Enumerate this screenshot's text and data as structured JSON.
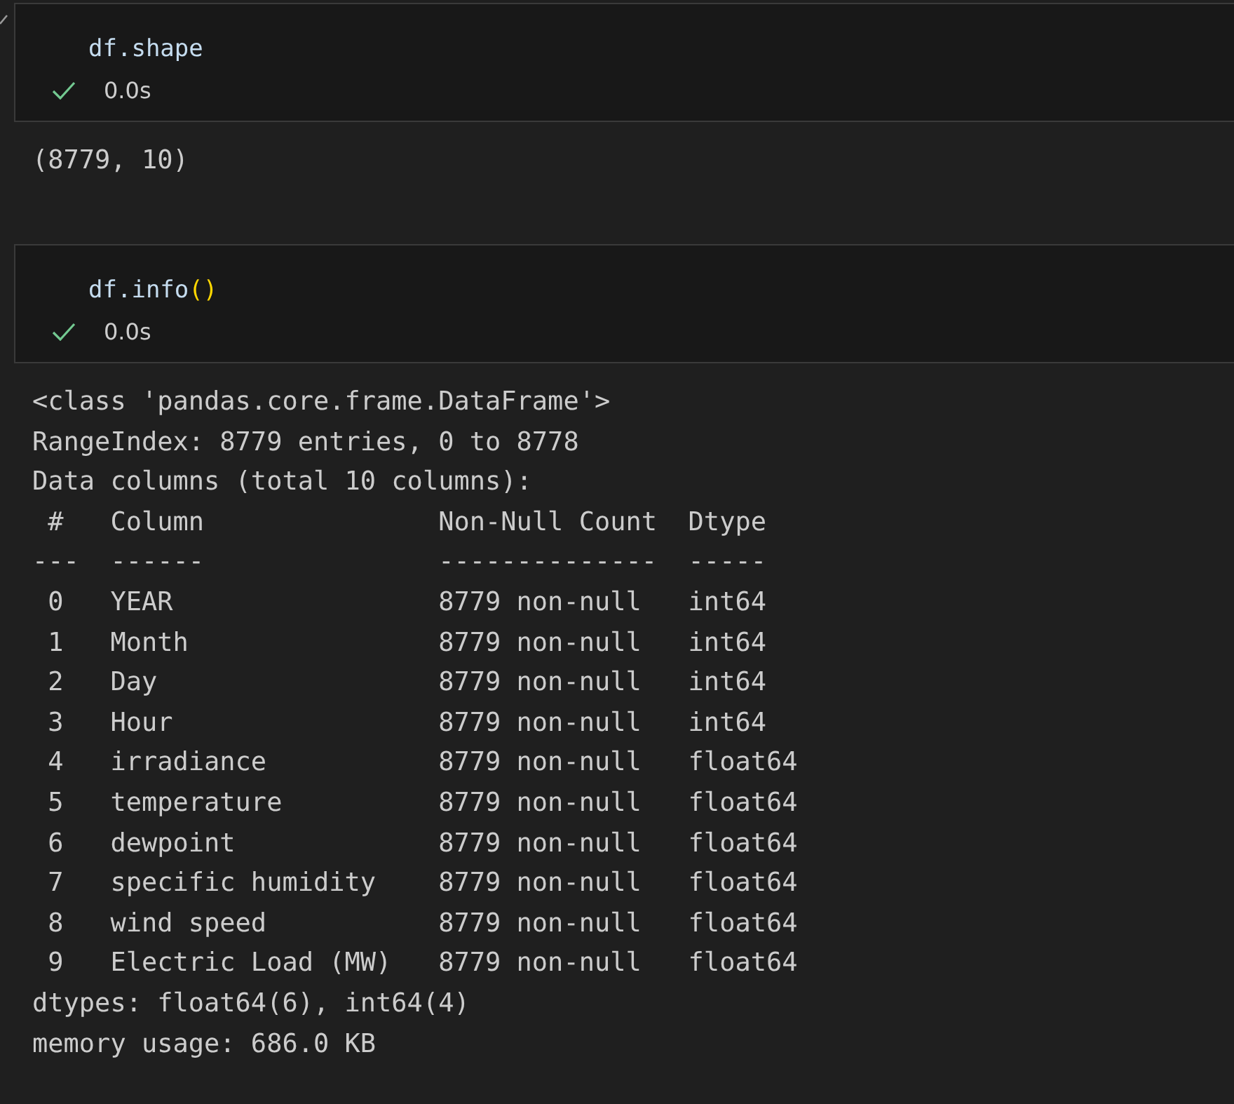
{
  "cells": [
    {
      "code": [
        {
          "kind": "plain",
          "text": "df.shape"
        }
      ],
      "succeeded": true,
      "time": "0.0s",
      "output": [
        "(8779, 10)"
      ]
    },
    {
      "code": [
        {
          "kind": "plain",
          "text": "df.info"
        },
        {
          "kind": "bracket",
          "text": "()"
        }
      ],
      "succeeded": true,
      "time": "0.0s",
      "output": [
        "<class 'pandas.core.frame.DataFrame'>",
        "RangeIndex: 8779 entries, 0 to 8778",
        "Data columns (total 10 columns):",
        " #   Column               Non-Null Count  Dtype  ",
        "---  ------               --------------  -----  ",
        " 0   YEAR                 8779 non-null   int64  ",
        " 1   Month                8779 non-null   int64  ",
        " 2   Day                  8779 non-null   int64  ",
        " 3   Hour                 8779 non-null   int64  ",
        " 4   irradiance           8779 non-null   float64",
        " 5   temperature          8779 non-null   float64",
        " 6   dewpoint             8779 non-null   float64",
        " 7   specific humidity    8779 non-null   float64",
        " 8   wind speed           8779 non-null   float64",
        " 9   Electric Load (MW)   8779 non-null   float64",
        "dtypes: float64(6), int64(4)",
        "memory usage: 686.0 KB"
      ]
    }
  ]
}
